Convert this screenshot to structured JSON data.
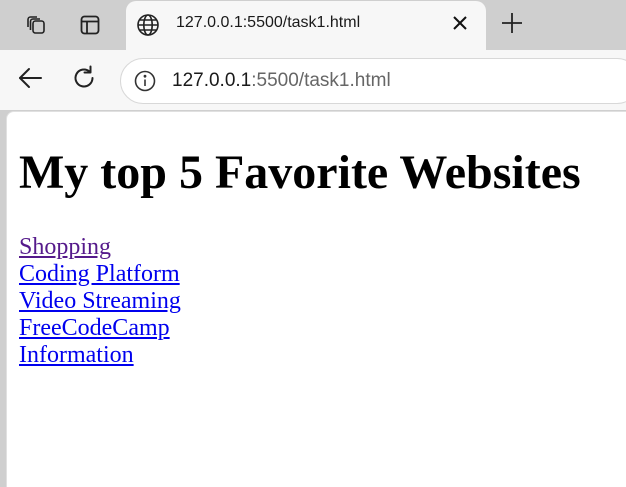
{
  "tab": {
    "title": "127.0.0.1:5500/task1.html"
  },
  "address_bar": {
    "host": "127.0.0.1",
    "rest": ":5500/task1.html"
  },
  "page": {
    "heading": "My top 5 Favorite Websites",
    "links": [
      {
        "label": "Shopping",
        "visited": true
      },
      {
        "label": "Coding Platform",
        "visited": false
      },
      {
        "label": "Video Streaming",
        "visited": false
      },
      {
        "label": "FreeCodeCamp",
        "visited": false
      },
      {
        "label": "Information",
        "visited": false
      }
    ]
  },
  "colors": {
    "link": "#0000ee",
    "visited_link": "#551a8b",
    "chrome_bg": "#cfcfcf",
    "toolbar_bg": "#f7f7f7"
  },
  "icons": [
    "tab-actions-icon",
    "vertical-tabs-icon",
    "globe-icon",
    "close-icon",
    "plus-icon",
    "back-arrow-icon",
    "refresh-icon",
    "info-icon"
  ]
}
